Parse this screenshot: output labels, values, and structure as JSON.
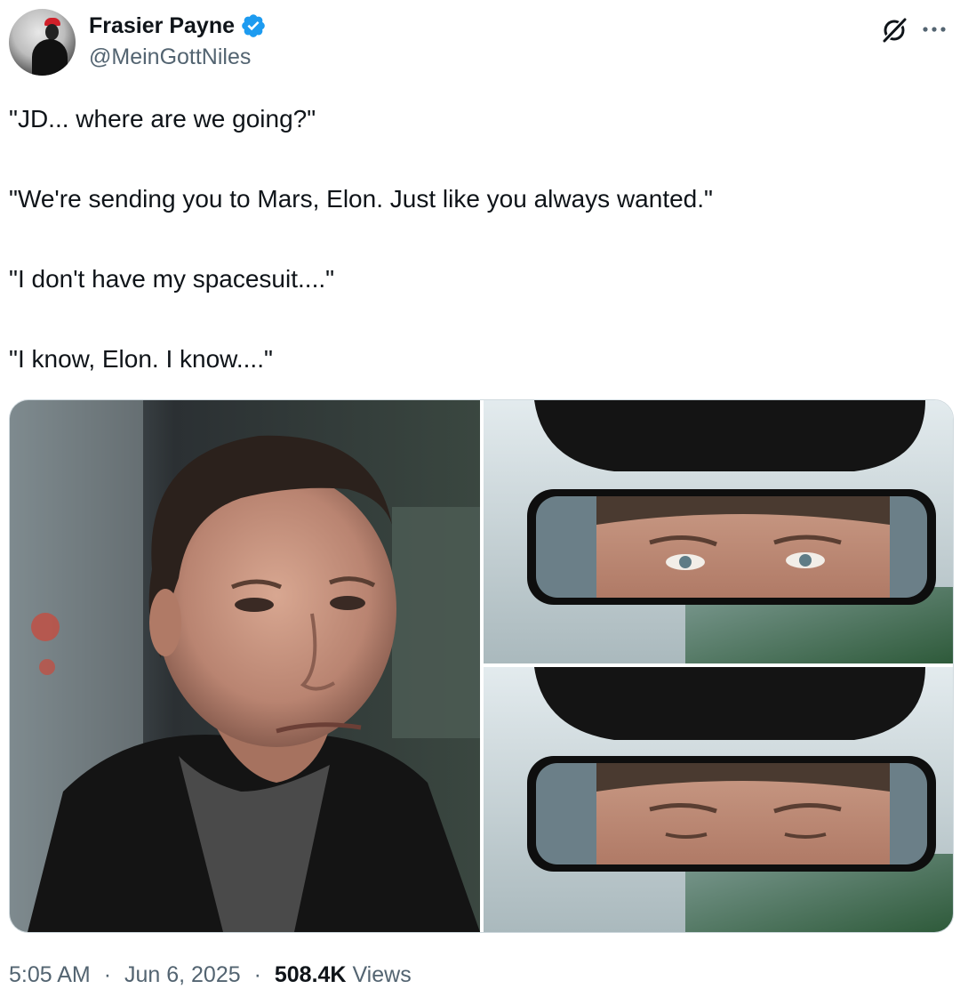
{
  "author": {
    "display_name": "Frasier Payne",
    "handle": "@MeinGottNiles",
    "verified": true
  },
  "icons": {
    "verified": "verified-badge-icon",
    "grok": "grok-icon",
    "more": "more-options-icon"
  },
  "tweet": {
    "lines": [
      "\"JD... where are we going?\"",
      "\"We're sending you to Mars, Elon. Just like you always wanted.\"",
      "\"I don't have my spacesuit....\"",
      "\"I know, Elon. I know....\""
    ]
  },
  "media": {
    "images": [
      "man-in-car-photo",
      "rearview-mirror-eyes-open",
      "rearview-mirror-eyes-closed"
    ]
  },
  "meta": {
    "time": "5:05 AM",
    "separator": "·",
    "date": "Jun 6, 2025",
    "views_count": "508.4K",
    "views_label": "Views"
  },
  "colors": {
    "text": "#0f1419",
    "secondary": "#536471",
    "verified": "#1d9bf0",
    "border": "#cfd9de"
  }
}
